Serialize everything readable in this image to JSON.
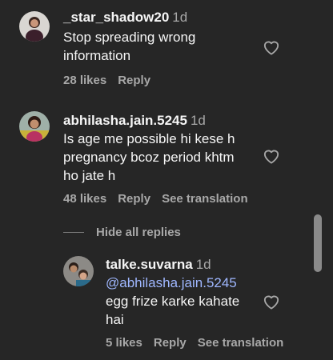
{
  "comments": [
    {
      "username": "_star_shadow20",
      "time": "1d",
      "text": "Stop spreading wrong information",
      "likes": "28 likes",
      "reply": "Reply"
    },
    {
      "username": "abhilasha.jain.5245",
      "time": "1d",
      "text": "Is age me possible hi kese h pregnancy bcoz period khtm ho jate h",
      "likes": "48 likes",
      "reply": "Reply",
      "translate": "See translation"
    }
  ],
  "hide_replies": "Hide all replies",
  "reply": {
    "username": "talke.suvarna",
    "time": "1d",
    "mention": "@abhilasha.jain.5245",
    "text": "egg frize karke kahate hai",
    "likes": "5 likes",
    "reply": "Reply",
    "translate": "See translation"
  },
  "icons": {
    "like": "heart-icon"
  },
  "colors": {
    "background": "#262626",
    "mention": "#9fb7ff",
    "muted": "#a8a8a8"
  }
}
